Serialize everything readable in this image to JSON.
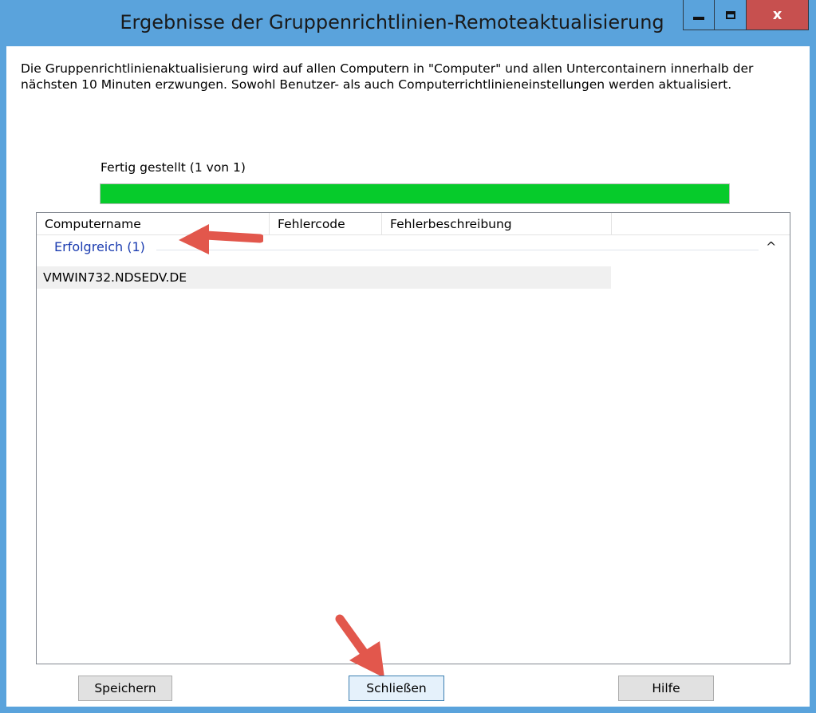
{
  "window": {
    "title": "Ergebnisse der Gruppenrichtlinien-Remoteaktualisierung",
    "close_glyph": "x"
  },
  "description": "Die Gruppenrichtlinienaktualisierung wird auf allen Computern in \"Computer\" und allen Untercontainern innerhalb der nächsten 10 Minuten erzwungen. Sowohl Benutzer- als auch Computerrichtlinieneinstellungen werden aktualisiert.",
  "status": {
    "label": "Fertig gestellt (1 von 1)",
    "progress_fraction": 1.0,
    "progress_color": "#06cb2b"
  },
  "list": {
    "columns": [
      "Computername",
      "Fehlercode",
      "Fehlerbeschreibung"
    ],
    "group": {
      "label": "Erfolgreich (1)",
      "chevron": "^"
    },
    "rows": [
      {
        "computer": "VMWIN732.NDSEDV.DE",
        "code": "",
        "description": ""
      }
    ]
  },
  "buttons": {
    "save": "Speichern",
    "close": "Schließen",
    "help": "Hilfe"
  },
  "colors": {
    "title_bar": "#5aa3dc",
    "close_button": "#c7504f",
    "group_text": "#1b3cb0",
    "annotation_arrow": "#e2574c"
  }
}
